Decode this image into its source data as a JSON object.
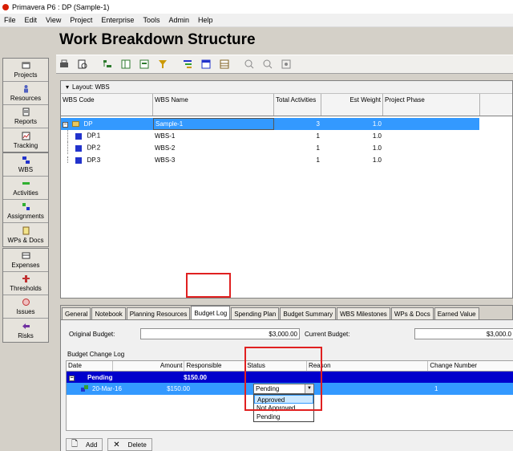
{
  "window": {
    "title": "Primavera P6 : DP (Sample-1)"
  },
  "menu": [
    "File",
    "Edit",
    "View",
    "Project",
    "Enterprise",
    "Tools",
    "Admin",
    "Help"
  ],
  "nav": {
    "group1": [
      {
        "label": "Projects",
        "icon": "projects-icon"
      },
      {
        "label": "Resources",
        "icon": "resources-icon"
      },
      {
        "label": "Reports",
        "icon": "reports-icon"
      },
      {
        "label": "Tracking",
        "icon": "tracking-icon"
      }
    ],
    "group2": [
      {
        "label": "WBS",
        "icon": "wbs-icon"
      },
      {
        "label": "Activities",
        "icon": "activities-icon"
      },
      {
        "label": "Assignments",
        "icon": "assignments-icon"
      },
      {
        "label": "WPs & Docs",
        "icon": "wps-docs-icon"
      }
    ],
    "group3": [
      {
        "label": "Expenses",
        "icon": "expenses-icon"
      },
      {
        "label": "Thresholds",
        "icon": "thresholds-icon"
      },
      {
        "label": "Issues",
        "icon": "issues-icon"
      },
      {
        "label": "Risks",
        "icon": "risks-icon"
      }
    ]
  },
  "page": {
    "title": "Work Breakdown Structure"
  },
  "grid": {
    "layout_label": "Layout: WBS",
    "columns": [
      "WBS Code",
      "WBS Name",
      "Total Activities",
      "Est Weight",
      "Project Phase"
    ],
    "rows": [
      {
        "code": "DP",
        "name": "Sample-1",
        "total": "3",
        "weight": "1.0"
      },
      {
        "code": "DP.1",
        "name": "WBS-1",
        "total": "1",
        "weight": "1.0"
      },
      {
        "code": "DP.2",
        "name": "WBS-2",
        "total": "1",
        "weight": "1.0"
      },
      {
        "code": "DP.3",
        "name": "WBS-3",
        "total": "1",
        "weight": "1.0"
      }
    ]
  },
  "tabs": [
    "General",
    "Notebook",
    "Planning Resources",
    "Budget Log",
    "Spending Plan",
    "Budget Summary",
    "WBS Milestones",
    "WPs & Docs",
    "Earned Value"
  ],
  "active_tab": "Budget Log",
  "budget": {
    "original_label": "Original Budget:",
    "original_value": "$3,000.00",
    "current_label": "Current Budget:",
    "current_value": "$3,000.0"
  },
  "change_log": {
    "title": "Budget Change Log",
    "columns": [
      "Date",
      "Amount",
      "Responsible",
      "Status",
      "Reason",
      "Change Number"
    ],
    "group": {
      "label": "Pending",
      "amount": "$150.00"
    },
    "row": {
      "date": "20-Mar-16",
      "amount": "$150.00",
      "status": "Pending",
      "change_number": "1"
    },
    "status_options": [
      "Approved",
      "Not Approved",
      "Pending"
    ]
  },
  "actions": {
    "add": "Add",
    "delete": "Delete"
  },
  "colors": {
    "selection": "#3399ff",
    "group_band": "#0000cc",
    "callout": "#e02020"
  }
}
